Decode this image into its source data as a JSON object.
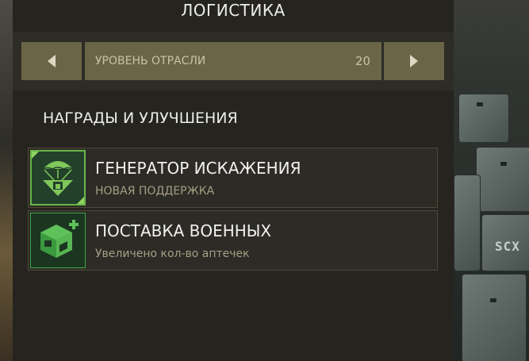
{
  "header": {
    "title": "ЛОГИСТИКА"
  },
  "level_bar": {
    "label": "УРОВЕНЬ ОТРАСЛИ",
    "value": "20",
    "prev_icon": "triangle-left",
    "next_icon": "triangle-right"
  },
  "section": {
    "title": "НАГРАДЫ И УЛУЧШЕНИЯ"
  },
  "rewards": [
    {
      "name": "ГЕНЕРАТОР ИСКАЖЕНИЯ",
      "description": "НОВАЯ ПОДДЕРЖКА",
      "icon": "parachute-drop-icon"
    },
    {
      "name": "ПОСТАВКА ВОЕННЫХ",
      "description": "Увеличено кол-во аптечек",
      "icon": "supply-box-plus-icon"
    }
  ],
  "background": {
    "crate_label": "SCX"
  },
  "colors": {
    "panel": "#25241f",
    "button": "#6b6547",
    "accent_green": "#6ab54a",
    "text": "#ececec"
  }
}
